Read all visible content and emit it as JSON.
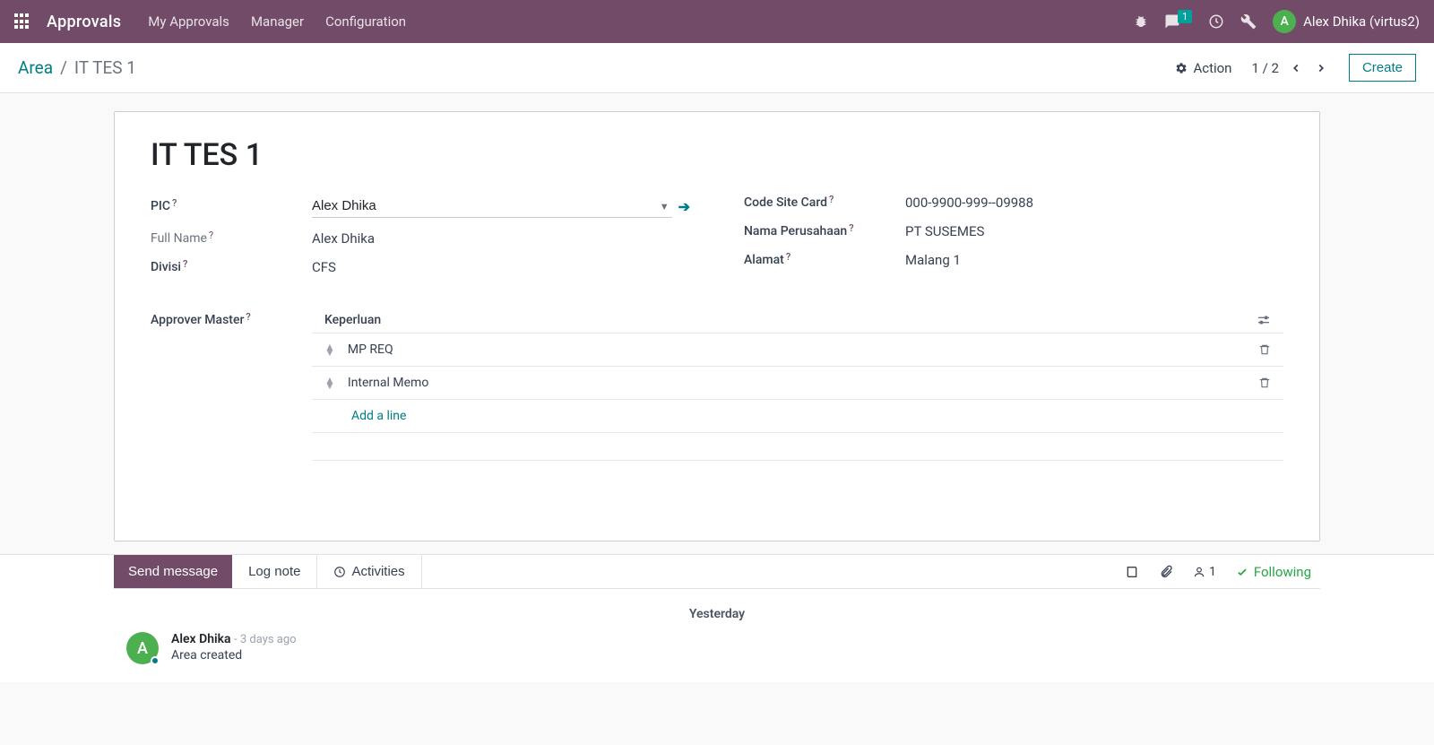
{
  "topbar": {
    "brand": "Approvals",
    "nav": [
      "My Approvals",
      "Manager",
      "Configuration"
    ],
    "msg_badge": "1",
    "user_initial": "A",
    "user_label": "Alex Dhika (virtus2)"
  },
  "subbar": {
    "breadcrumb_root": "Area",
    "breadcrumb_sep": "/",
    "breadcrumb_active": "IT TES 1",
    "action_label": "Action",
    "pager_text": "1 / 2",
    "create_label": "Create"
  },
  "form": {
    "title": "IT TES 1",
    "left": {
      "pic_label": "PIC",
      "pic_value": "Alex Dhika",
      "fullname_label": "Full Name",
      "fullname_value": "Alex Dhika",
      "divisi_label": "Divisi",
      "divisi_value": "CFS"
    },
    "right": {
      "code_label": "Code Site Card",
      "code_value": "000-9900-999--09988",
      "company_label": "Nama Perusahaan",
      "company_value": "PT SUSEMES",
      "alamat_label": "Alamat",
      "alamat_value": "Malang 1"
    },
    "approver": {
      "label": "Approver Master",
      "col_header": "Keperluan",
      "rows": [
        "MP REQ",
        "Internal Memo"
      ],
      "add_line": "Add a line"
    },
    "help": "?"
  },
  "chatter": {
    "send": "Send message",
    "lognote": "Log note",
    "activities": "Activities",
    "follower_count": "1",
    "following": "Following",
    "date_sep": "Yesterday",
    "msg_author": "Alex Dhika",
    "msg_time": "- 3 days ago",
    "msg_text": "Area created",
    "msg_initial": "A"
  }
}
